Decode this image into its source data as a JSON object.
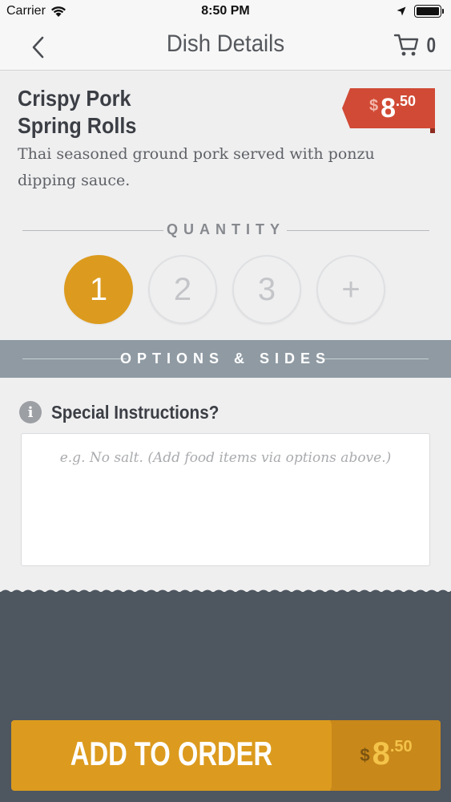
{
  "status_bar": {
    "carrier": "Carrier",
    "time": "8:50 PM"
  },
  "nav": {
    "title": "Dish Details",
    "cart_count": "0"
  },
  "dish": {
    "name_line1": "Crispy Pork",
    "name_line2": "Spring Rolls",
    "description": "Thai seasoned ground pork served with ponzu dipping sauce.",
    "price_symbol": "$",
    "price_main": "8",
    "price_cents": ".50"
  },
  "quantity": {
    "label": "QUANTITY",
    "options": [
      "1",
      "2",
      "3",
      "+"
    ],
    "selected": "1"
  },
  "options": {
    "label": "OPTIONS & SIDES"
  },
  "special_instructions": {
    "label": "Special Instructions?",
    "placeholder": "e.g. No salt. (Add food items via options above.)"
  },
  "add_button": {
    "label": "ADD TO ORDER",
    "price_symbol": "$",
    "price_main": "8",
    "price_cents": ".50"
  },
  "colors": {
    "accent": "#dc9b1e",
    "price_tag": "#d14a35",
    "options_band": "#8f9aa3",
    "footer": "#4e5660"
  }
}
